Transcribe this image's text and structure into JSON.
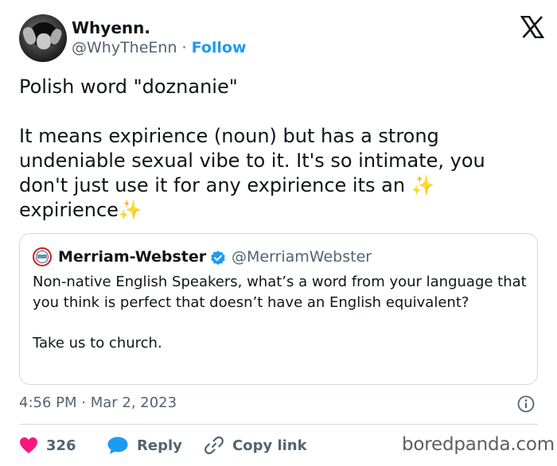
{
  "author": {
    "display_name": "Whyenn.",
    "handle": "@WhyTheEnn",
    "separator": "·",
    "follow_label": "Follow"
  },
  "tweet": {
    "text": "Polish word \"doznanie\"\n\nIt means expirience (noun) but has a strong undeniable sexual vibe to it. It's so intimate, you don't just use it for any expirience its an ✨ expirience✨",
    "timestamp": "4:56 PM · Mar 2, 2023"
  },
  "quote": {
    "display_name": "Merriam-Webster",
    "handle": "@MerriamWebster",
    "text": "Non-native English Speakers, what’s a word from your language that you think is perfect that doesn’t have an English equivalent?\n\nTake us to church."
  },
  "actions": {
    "like_count": "326",
    "reply_label": "Reply",
    "copy_link_label": "Copy link"
  },
  "watermark": "boredpanda.com",
  "colors": {
    "accent": "#1d9bf0",
    "like": "#f91880",
    "text": "#0f1419",
    "secondary": "#536471",
    "border": "#cfd9de"
  },
  "icons": {
    "brand": "x-logo-icon",
    "verified": "verified-badge-icon",
    "info": "info-icon",
    "like": "heart-icon",
    "reply": "speech-bubble-icon",
    "copy": "link-icon"
  }
}
